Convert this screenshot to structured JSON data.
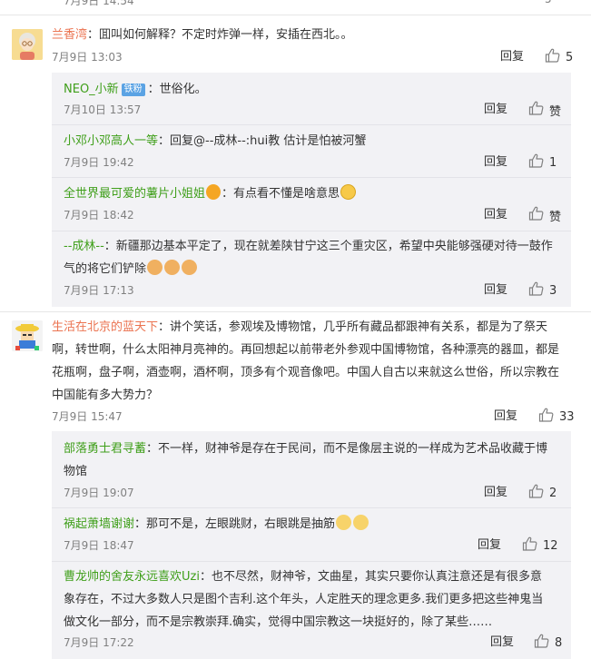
{
  "top": {
    "time": "7月9日 14:54",
    "likes": "5"
  },
  "labels": {
    "reply": "回复",
    "like_zero": "赞"
  },
  "comments": [
    {
      "user": "兰香湾",
      "text": "：囬叫如何解释？不定时炸弹一样，安插在西北。。",
      "time": "7月9日 13:03",
      "likes": "5",
      "avatar": "grandma-avatar",
      "replies": [
        {
          "user": "NEO_小新",
          "badge": "铁粉",
          "text": "：世俗化。",
          "time": "7月10日 13:57",
          "likes": "赞"
        },
        {
          "user": "小邓小邓高人一等",
          "text": "：回复@--成林--:hui教  估计是怕被河蟹",
          "time": "7月9日 19:42",
          "likes": "1"
        },
        {
          "user": "全世界最可爱的薯片小姐姐",
          "text": "：有点看不懂是啥意思",
          "time": "7月9日 18:42",
          "likes": "赞"
        },
        {
          "user": "--成林--",
          "text_line1": "：新疆那边基本平定了，现在就差陕甘宁这三个重灾区，希望中央能够强硬对待一鼓作",
          "text_line2": "气的将它们铲除",
          "time": "7月9日 17:13",
          "likes": "3"
        }
      ]
    },
    {
      "user": "生活在北京的蓝天下",
      "text_line1": "：讲个笑话，参观埃及博物馆，几乎所有藏品都跟神有关系，都是为了祭天",
      "text_line2": "啊，转世啊，什么太阳神月亮神的。再回想起以前带老外参观中国博物馆，各种漂亮的器皿，都是",
      "text_line3": "花瓶啊，盘子啊，酒壶啊，酒杯啊，顶多有个观音像吧。中国人自古以来就这么世俗，所以宗教在",
      "text_line4": "中国能有多大势力？",
      "time": "7月9日 15:47",
      "likes": "33",
      "avatar": "cartoon-avatar",
      "replies": [
        {
          "user": "部落勇士君寻蓄",
          "text_line1": "：不一样，财神爷是存在于民间，而不是像层主说的一样成为艺术品收藏于博",
          "text_line2": "物馆",
          "time": "7月9日 19:07",
          "likes": "2"
        },
        {
          "user": "祸起萧墙谢谢",
          "text": "：那可不是，左眼跳财，右眼跳是抽筋",
          "time": "7月9日 18:47",
          "likes": "12"
        },
        {
          "user": "曹龙帅的舍友永远喜欢Uzi",
          "text_line1": "：也不尽然，财神爷，文曲星，其实只要你认真注意还是有很多意",
          "text_line2": "象存在，不过大多数人只是图个吉利.这个年头，人定胜天的理念更多.我们更多把这些神鬼当",
          "text_line3": "做文化一部分，而不是宗教崇拜.确实，觉得中国宗教这一块挺好的，除了某些……",
          "time": "7月9日 17:22",
          "likes": "8"
        }
      ]
    }
  ]
}
